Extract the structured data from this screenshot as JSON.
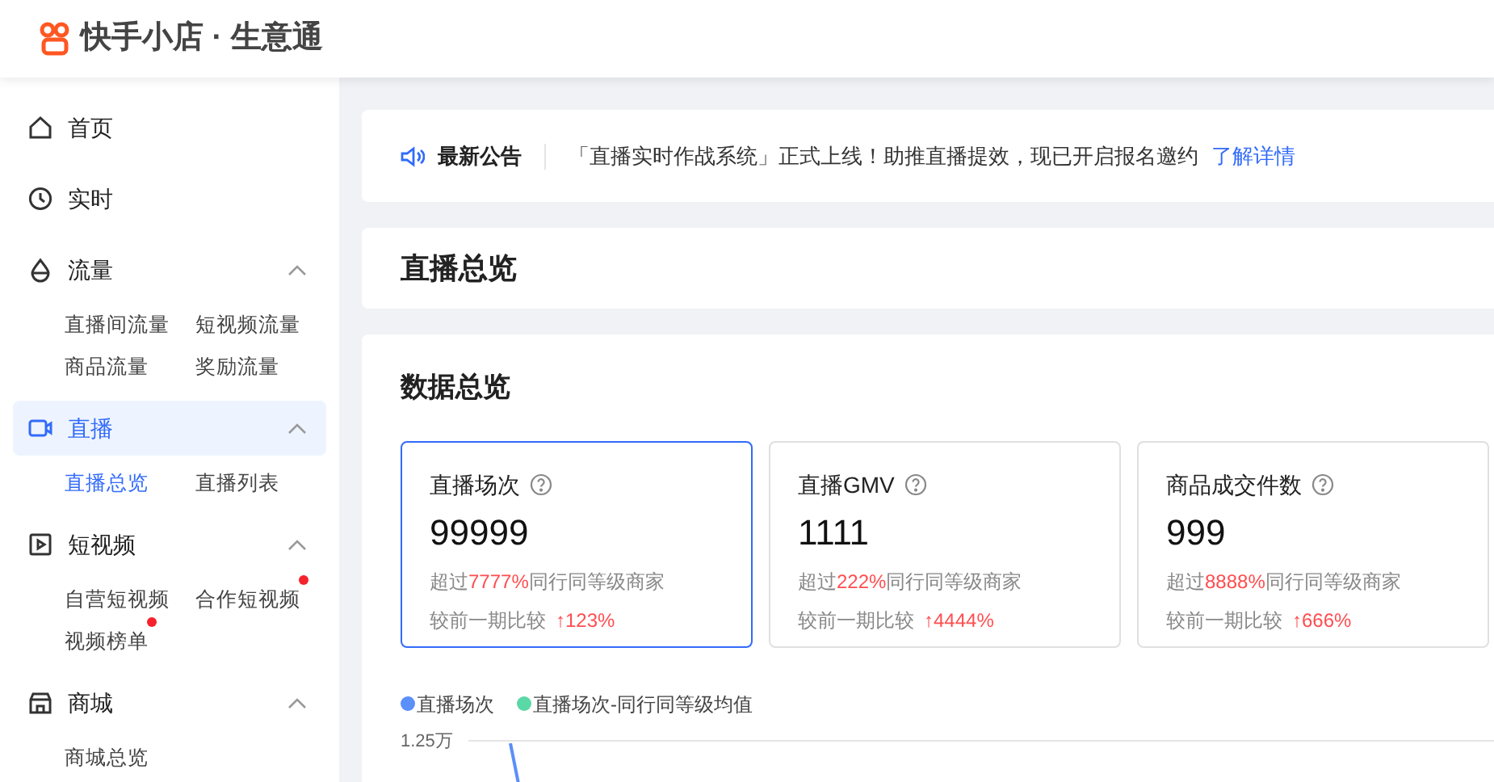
{
  "header": {
    "logo_text": "快手小店 · 生意通"
  },
  "sidebar": {
    "items": [
      {
        "label": "首页",
        "kind": "home",
        "selected": false
      },
      {
        "label": "实时",
        "kind": "clock",
        "selected": false
      },
      {
        "label": "流量",
        "kind": "drop",
        "selected": false,
        "expanded": true,
        "children": [
          {
            "label": "直播间流量",
            "selected": false,
            "dot": false
          },
          {
            "label": "短视频流量",
            "selected": false,
            "dot": false
          },
          {
            "label": "商品流量",
            "selected": false,
            "dot": false
          },
          {
            "label": "奖励流量",
            "selected": false,
            "dot": false
          }
        ]
      },
      {
        "label": "直播",
        "kind": "camera",
        "selected": true,
        "expanded": true,
        "children": [
          {
            "label": "直播总览",
            "selected": true,
            "dot": false
          },
          {
            "label": "直播列表",
            "selected": false,
            "dot": false
          }
        ]
      },
      {
        "label": "短视频",
        "kind": "play",
        "selected": false,
        "expanded": true,
        "children": [
          {
            "label": "自营短视频",
            "selected": false,
            "dot": false
          },
          {
            "label": "合作短视频",
            "selected": false,
            "dot": true
          },
          {
            "label": "视频榜单",
            "selected": false,
            "dot": true
          }
        ]
      },
      {
        "label": "商城",
        "kind": "store",
        "selected": false,
        "expanded": true,
        "children": [
          {
            "label": "商城总览",
            "selected": false,
            "dot": false
          }
        ]
      }
    ]
  },
  "notice": {
    "title": "最新公告",
    "text": "「直播实时作战系统」正式上线！助推直播提效，现已开启报名邀约",
    "link": "了解详情"
  },
  "page_title": "直播总览",
  "data_section": {
    "title": "数据总览",
    "cards": [
      {
        "label": "直播场次",
        "value": "99999",
        "exceed_prefix": "超过",
        "exceed_value": "7777%",
        "exceed_suffix": "同行同等级商家",
        "compare_label": "较前一期比较",
        "compare_value": "↑123%",
        "selected": true
      },
      {
        "label": "直播GMV",
        "value": "1111",
        "exceed_prefix": "超过",
        "exceed_value": "222%",
        "exceed_suffix": "同行同等级商家",
        "compare_label": "较前一期比较",
        "compare_value": "↑4444%",
        "selected": false
      },
      {
        "label": "商品成交件数",
        "value": "999",
        "exceed_prefix": "超过",
        "exceed_value": "8888%",
        "exceed_suffix": "同行同等级商家",
        "compare_label": "较前一期比较",
        "compare_value": "↑666%",
        "selected": false
      }
    ],
    "chart": {
      "legend": [
        {
          "label": "直播场次",
          "color": "#5b8ff9"
        },
        {
          "label": "直播场次-同行同等级均值",
          "color": "#5ad8a6"
        }
      ],
      "y_tick": "1.25万"
    }
  }
}
